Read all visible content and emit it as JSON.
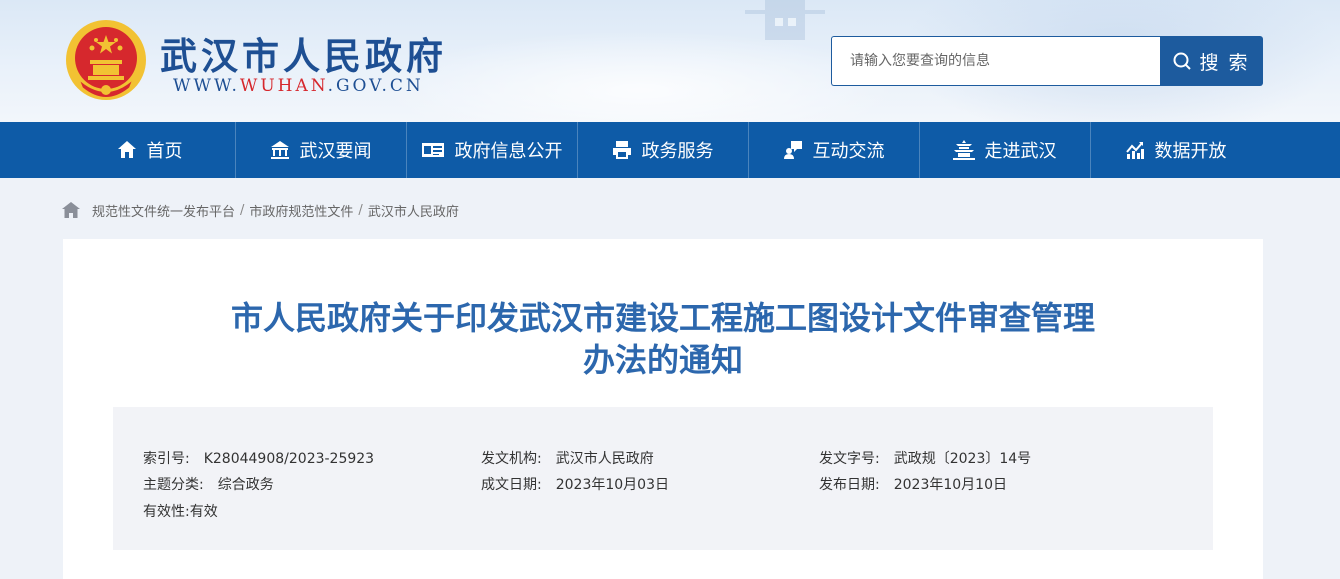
{
  "header": {
    "site_title": "武汉市人民政府",
    "url_prefix": "WWW.",
    "url_highlight": "WUHAN",
    "url_suffix": ".GOV.CN",
    "search_placeholder": "请输入您要查询的信息",
    "search_button": "搜 索"
  },
  "nav": {
    "items": [
      {
        "label": "首页",
        "icon": "home-icon"
      },
      {
        "label": "武汉要闻",
        "icon": "building-icon"
      },
      {
        "label": "政府信息公开",
        "icon": "id-card-icon"
      },
      {
        "label": "政务服务",
        "icon": "printer-icon"
      },
      {
        "label": "互动交流",
        "icon": "chat-user-icon"
      },
      {
        "label": "走进武汉",
        "icon": "pagoda-icon"
      },
      {
        "label": "数据开放",
        "icon": "chart-icon"
      }
    ]
  },
  "breadcrumb": {
    "items": [
      "规范性文件统一发布平台",
      "市政府规范性文件",
      "武汉市人民政府"
    ],
    "separator": "/"
  },
  "document": {
    "title_line1": "市人民政府关于印发武汉市建设工程施工图设计文件审查管理",
    "title_line2": "办法的通知",
    "meta": {
      "index_label": "索引号:",
      "index_value": "K28044908/2023-25923",
      "org_label": "发文机构:",
      "org_value": "武汉市人民政府",
      "docno_label": "发文字号:",
      "docno_value": "武政规〔2023〕14号",
      "topic_label": "主题分类:",
      "topic_value": "综合政务",
      "created_label": "成文日期:",
      "created_value": "2023年10月03日",
      "published_label": "发布日期:",
      "published_value": "2023年10月10日",
      "validity_label": "有效性:",
      "validity_value": "有效"
    }
  },
  "colors": {
    "brand_blue": "#0e5ba7",
    "title_blue": "#2c67ad",
    "emblem_red": "#d6282d",
    "emblem_gold": "#f2c233"
  }
}
